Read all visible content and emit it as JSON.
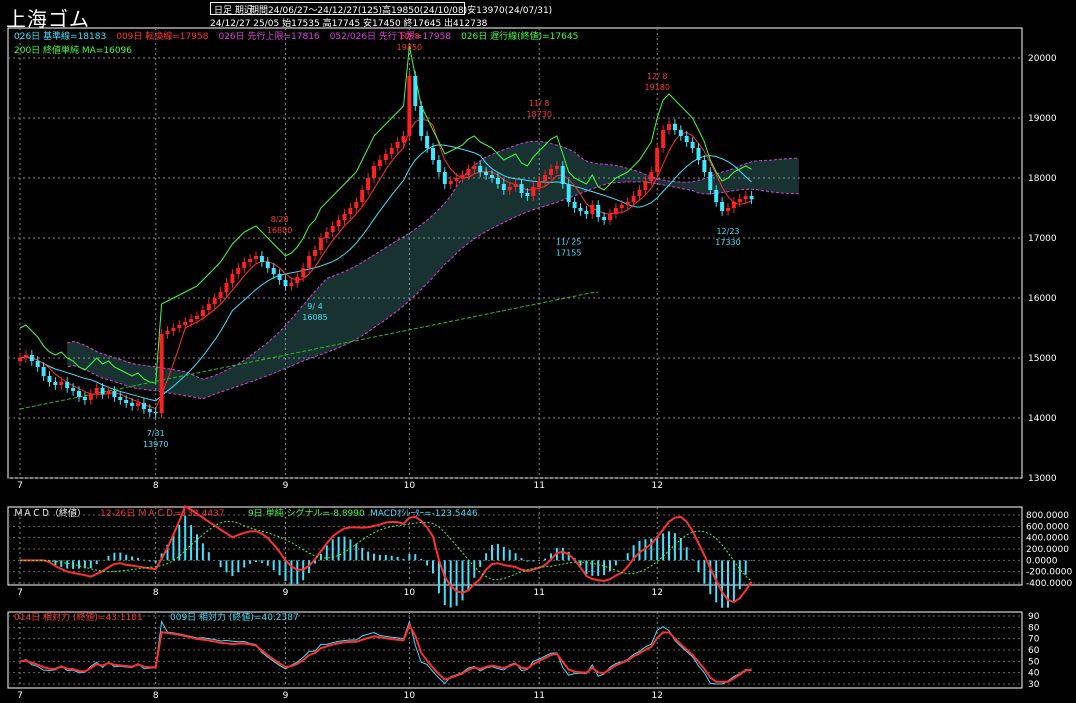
{
  "title": "上海ゴム",
  "header": {
    "mode": "日足 期近",
    "period_line": "期間24/06/27〜24/12/27(125)高19850(24/10/08)安13970(24/07/31)",
    "ohlc_line": "24/12/27 25/05 始17535 高17745 安17450 終17645 出412738"
  },
  "legend_main": [
    {
      "text": "026日 基準線=18183",
      "color": "#40e0ff"
    },
    {
      "text": "009日 転換線=17958",
      "color": "#ff3030"
    },
    {
      "text": "026日 先行上限=17816",
      "color": "#e040e0"
    },
    {
      "text": "052/026日 先行下限=17958",
      "color": "#e040e0"
    },
    {
      "text": "026日 遅行線(終値)=17645",
      "color": "#40ff40"
    },
    {
      "text": "200日 終値単純 MA=16096",
      "color": "#40ff40"
    }
  ],
  "macd": {
    "label": "ＭＡＣＤ（終値）",
    "macd_text": "12-26日 ＭＡＣＤ=132.4437",
    "signal_text": "9日 単純 シグナル=-8.8990",
    "osc_text": "MACDｵｼﾚｰﾀｰ=-123.5446",
    "ticks": [
      "800.0000",
      "600.0000",
      "400.0000",
      "200.0000",
      "0.0000",
      "-200.0000",
      "-400.0000"
    ]
  },
  "rsi": {
    "rsi14_text": "014日 相対力 (終値)=43.1101",
    "rsi9_text": "009日 相対力 (終値)=40.2387",
    "ticks": [
      "90",
      "80",
      "70",
      "60",
      "50",
      "40",
      "30"
    ]
  },
  "chart_data": {
    "type": "candlestick",
    "ylim": [
      13000,
      20500
    ],
    "yticks": [
      "20000",
      "19000",
      "18000",
      "17000",
      "16000",
      "15000",
      "14000",
      "13000"
    ],
    "month_labels": [
      "7",
      "8",
      "9",
      "10",
      "11",
      "12"
    ],
    "month_index": [
      0,
      23,
      45,
      66,
      88,
      108
    ],
    "annotations": [
      {
        "date": "10/ 8",
        "value": "19850",
        "color": "#ff3030"
      },
      {
        "date": "11/ 8",
        "value": "18730",
        "color": "#ff3030"
      },
      {
        "date": "12/ 8",
        "value": "19180",
        "color": "#ff3030"
      },
      {
        "date": "8/28",
        "value": "16800",
        "color": "#ff3030"
      },
      {
        "date": "9/ 4",
        "value": "16085",
        "color": "#40e0ff"
      },
      {
        "date": "7/31",
        "value": "13970",
        "color": "#40e0ff"
      },
      {
        "date": "11/ 25",
        "value": "17155",
        "color": "#40e0ff"
      },
      {
        "date": "12/23",
        "value": "17330",
        "color": "#40e0ff"
      }
    ],
    "close": [
      15000,
      15050,
      14950,
      14850,
      14700,
      14600,
      14550,
      14600,
      14500,
      14450,
      14350,
      14300,
      14400,
      14500,
      14400,
      14450,
      14350,
      14300,
      14250,
      14200,
      14250,
      14150,
      14100,
      14080,
      15400,
      15450,
      15500,
      15550,
      15600,
      15650,
      15700,
      15800,
      15900,
      16000,
      16100,
      16250,
      16400,
      16500,
      16600,
      16650,
      16700,
      16600,
      16500,
      16400,
      16300,
      16200,
      16250,
      16350,
      16500,
      16700,
      16800,
      17000,
      17100,
      17200,
      17300,
      17400,
      17500,
      17600,
      17800,
      18000,
      18200,
      18300,
      18400,
      18500,
      18600,
      18700,
      19700,
      19200,
      18700,
      18500,
      18300,
      18100,
      17900,
      17950,
      18000,
      18050,
      18150,
      18200,
      18100,
      18050,
      18000,
      17900,
      17800,
      17850,
      17900,
      17750,
      17700,
      17850,
      17950,
      18050,
      18150,
      18200,
      17900,
      17600,
      17500,
      17450,
      17400,
      17550,
      17350,
      17300,
      17400,
      17500,
      17550,
      17600,
      17700,
      17800,
      17950,
      18100,
      18500,
      18800,
      18900,
      18800,
      18700,
      18600,
      18500,
      18300,
      18100,
      17800,
      17600,
      17450,
      17500,
      17600,
      17650,
      17700,
      17645
    ],
    "ma200": [
      14150,
      14170,
      14190,
      14210,
      14230,
      14250,
      14270,
      14290,
      14310,
      14330,
      14350,
      14370,
      14390,
      14410,
      14430,
      14450,
      14470,
      14490,
      14510,
      14530,
      14550,
      14570,
      14590,
      14610,
      14630,
      14650,
      14670,
      14690,
      14710,
      14730,
      14750,
      14770,
      14790,
      14810,
      14830,
      14850,
      14870,
      14890,
      14910,
      14930,
      14950,
      14970,
      14990,
      15010,
      15030,
      15050,
      15070,
      15090,
      15110,
      15130,
      15150,
      15170,
      15190,
      15210,
      15230,
      15250,
      15270,
      15290,
      15310,
      15330,
      15350,
      15370,
      15390,
      15410,
      15430,
      15450,
      15470,
      15490,
      15510,
      15530,
      15550,
      15570,
      15590,
      15610,
      15630,
      15650,
      15670,
      15690,
      15710,
      15730,
      15750,
      15770,
      15790,
      15810,
      15830,
      15850,
      15870,
      15890,
      15910,
      15930,
      15950,
      15970,
      15990,
      16010,
      16030,
      16050,
      16070,
      16090,
      16096
    ]
  }
}
